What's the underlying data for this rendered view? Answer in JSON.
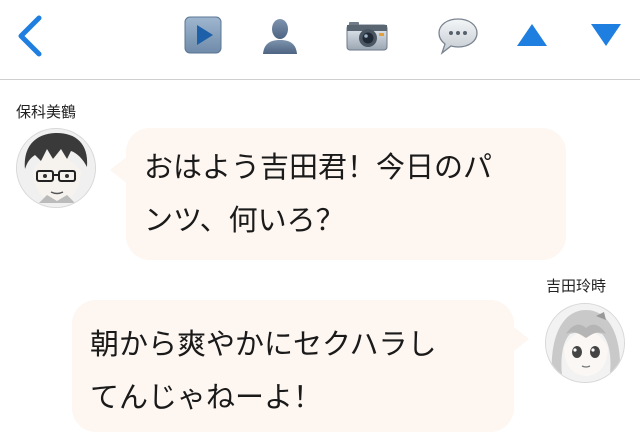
{
  "toolbar": {
    "icons": {
      "back": "chevron-left-icon",
      "play": "play-icon",
      "person": "person-icon",
      "camera": "camera-icon",
      "chat": "speech-bubble-icon",
      "up": "triangle-up-icon",
      "down": "triangle-down-icon"
    },
    "accent_color": "#1e7fe0"
  },
  "messages": [
    {
      "sender": "保科美鶴",
      "side": "left",
      "lines": [
        "おはよう吉田君！今日のパ",
        "ンツ、何いろ？"
      ]
    },
    {
      "sender": "吉田玲時",
      "side": "right",
      "lines": [
        "朝から爽やかにセクハラし",
        "てんじゃねーよ！"
      ]
    }
  ],
  "bubble_color": "#fdf6f1"
}
